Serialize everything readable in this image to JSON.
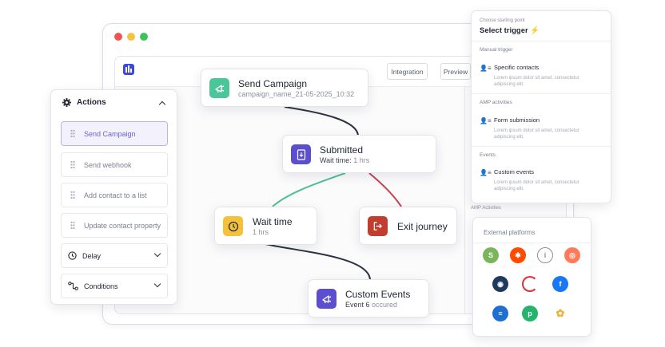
{
  "window": {
    "dot_colors": [
      "#f0544f",
      "#f6c244",
      "#3ec35a"
    ]
  },
  "toolbar": {
    "integration_label": "Integration",
    "preview_label": "Preview"
  },
  "actions_panel": {
    "title": "Actions",
    "items": [
      {
        "label": "Send Campaign",
        "selected": true
      },
      {
        "label": "Send webhook",
        "selected": false
      },
      {
        "label": "Add contact to a list",
        "selected": false
      },
      {
        "label": "Update contact property",
        "selected": false
      }
    ],
    "groups": [
      {
        "label": "Delay"
      },
      {
        "label": "Conditions"
      }
    ]
  },
  "flow": {
    "send_campaign": {
      "title": "Send Campaign",
      "subtitle": "campaign_name_21-05-2025_10:32",
      "icon": "megaphone-icon",
      "color": "#4cc59a"
    },
    "submitted": {
      "title": "Submitted",
      "subtitle_label": "Wait time:",
      "subtitle_value": "1 hrs",
      "icon": "form-icon",
      "color": "#5b4fd0"
    },
    "wait_time": {
      "title": "Wait time",
      "subtitle": "1 hrs",
      "icon": "timer-icon",
      "color": "#f5c13b"
    },
    "exit_journey": {
      "title": "Exit journey",
      "icon": "exit-icon",
      "color": "#c33d2e"
    },
    "custom_events": {
      "title": "Custom Events",
      "subtitle_label": "Event 6",
      "subtitle_value": "occured",
      "icon": "megaphone-icon",
      "color": "#5b4fd0"
    },
    "edge_colors": {
      "default": "#2e3340",
      "yes": "#4fbf95",
      "no": "#c8414e"
    }
  },
  "trigger_panel": {
    "caption": "Choose starting point",
    "title": "Select trigger",
    "sections": [
      {
        "name": "Manual trigger",
        "option": "Specific contacts",
        "description": "Lorem ipsum dolor sit amet, consectetur adipiscing elit."
      },
      {
        "name": "AMP activities",
        "option": "Form submission",
        "description": "Lorem ipsum dolor sit amet, consectetur adipiscing elit."
      },
      {
        "name": "Events",
        "option": "Custom events",
        "description": "Lorem ipsum dolor sit amet, consectetur adipiscing elit."
      }
    ]
  },
  "amp_label": "AMP Activities",
  "platforms_panel": {
    "title": "External platforms",
    "icons": [
      {
        "name": "shopify-icon",
        "color": "#7ab55c"
      },
      {
        "name": "zapier-icon",
        "color": "#ff4a00"
      },
      {
        "name": "intercom-icon",
        "color": "#8b9097"
      },
      {
        "name": "hubspot-icon",
        "color": "#ff7a59"
      },
      {
        "name": "contact-icon",
        "color": "#1f3a5f"
      },
      {
        "name": "crescent-icon",
        "color": "#e02d3a"
      },
      {
        "name": "facebook-icon",
        "color": "#1877f2"
      },
      {
        "name": "list-icon",
        "color": "#1f6fd1"
      },
      {
        "name": "pipedrive-icon",
        "color": "#26b36b"
      },
      {
        "name": "bloom-icon",
        "color": "#f1b23a"
      }
    ]
  }
}
